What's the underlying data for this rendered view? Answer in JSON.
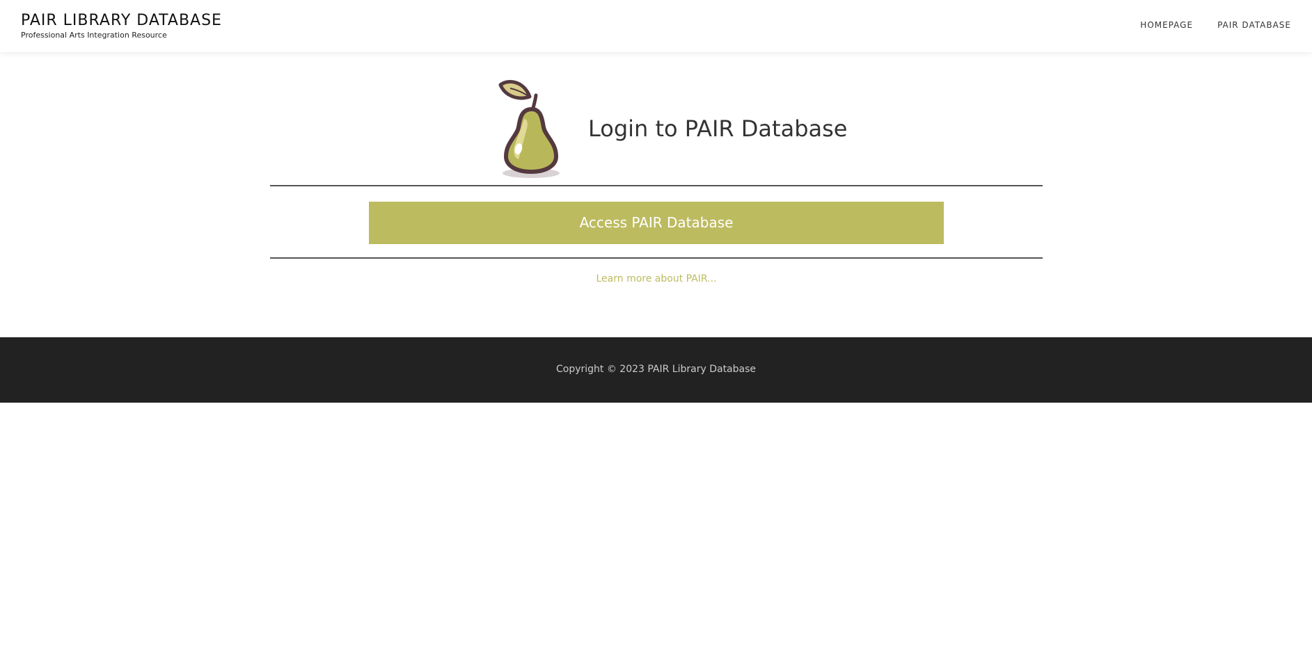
{
  "header": {
    "site_title": "PAIR LIBRARY DATABASE",
    "tagline": "Professional Arts Integration Resource",
    "nav": [
      {
        "label": "HOMEPAGE"
      },
      {
        "label": "PAIR DATABASE"
      }
    ]
  },
  "main": {
    "logo_icon": "pear-icon",
    "heading": "Login to PAIR Database",
    "access_button_label": "Access PAIR Database",
    "learn_more_link": "Learn more about PAIR..."
  },
  "footer": {
    "copyright": "Copyright © 2023 PAIR Library Database"
  },
  "colors": {
    "accent": "#bdbb60",
    "footer_bg": "#222222",
    "pear_outline": "#54393f",
    "pear_fill": "#b8b85a"
  }
}
